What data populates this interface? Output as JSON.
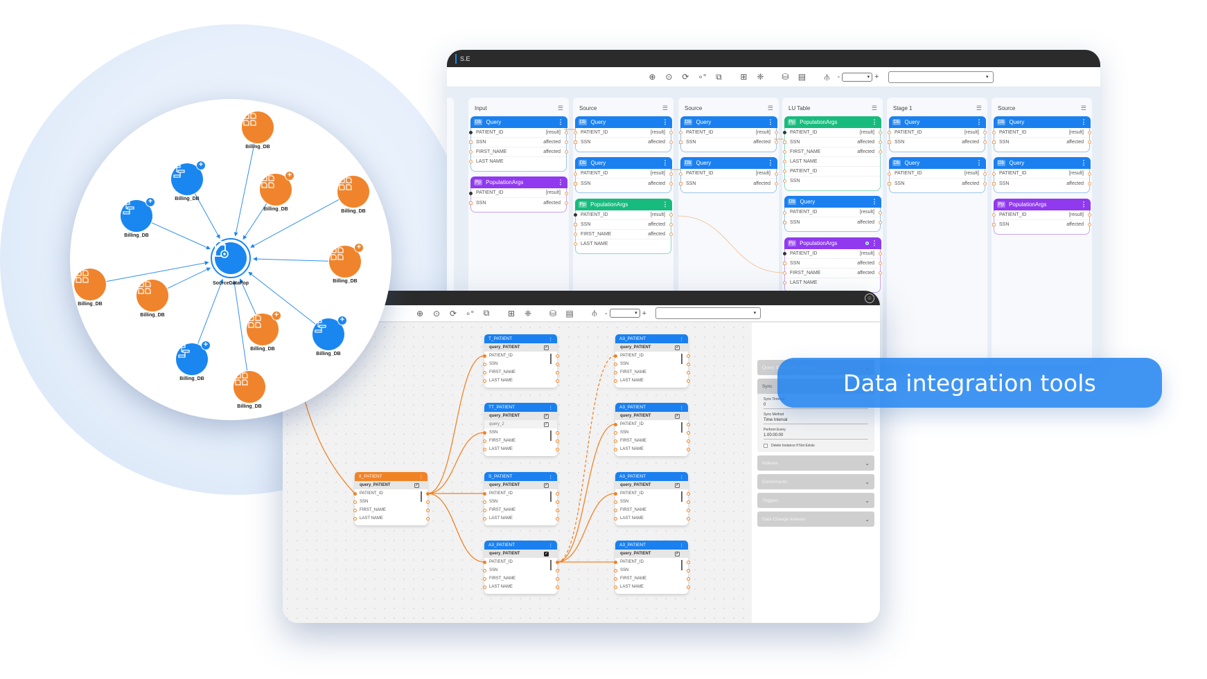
{
  "banner": {
    "text": "Data integration tools"
  },
  "colors": {
    "blue": "#1a80f0",
    "green": "#17bb7d",
    "purple": "#9039ef",
    "orange": "#f08226",
    "titlebar": "#2b2b2b"
  },
  "top_window": {
    "title": "S.E",
    "toolbar": {
      "icons": [
        "zoom-in-icon",
        "add-circle-icon",
        "refresh-icon",
        "nodes-icon",
        "group-icon",
        "add-table-icon",
        "network-icon",
        "db-search-icon",
        "table-search-icon",
        "hierarchy-icon"
      ],
      "zoom_minus": "-",
      "zoom_plus": "+",
      "zoom_value": "▾",
      "select_value": "▾"
    },
    "columns": [
      {
        "title": "Input",
        "nodes": [
          {
            "type": "Db",
            "name": "Query",
            "color": "blue",
            "rows": [
              {
                "left": "PATIENT_ID",
                "right": "[result]"
              },
              {
                "left": "SSN",
                "right": "affected"
              },
              {
                "left": "FIRST_NAME",
                "right": "affected"
              },
              {
                "left": "LAST NAME",
                "right": ""
              }
            ]
          },
          {
            "type": "Pp",
            "name": "PopulationArgs",
            "color": "purple",
            "rows": [
              {
                "left": "PATIENT_ID",
                "right": "[result]"
              },
              {
                "left": "SSN",
                "right": "affected"
              }
            ]
          }
        ]
      },
      {
        "title": "Source",
        "nodes": [
          {
            "type": "Db",
            "name": "Query",
            "color": "blue",
            "rows": [
              {
                "left": "PATIENT_ID",
                "right": "[result]"
              },
              {
                "left": "SSN",
                "right": "affected"
              }
            ]
          },
          {
            "type": "Db",
            "name": "Query",
            "color": "blue",
            "rows": [
              {
                "left": "PATIENT_ID",
                "right": "[result]"
              },
              {
                "left": "SSN",
                "right": "affected"
              }
            ]
          },
          {
            "type": "Pp",
            "name": "PopulationArgs",
            "color": "green",
            "rows": [
              {
                "left": "PATIENT_ID",
                "right": "[result]"
              },
              {
                "left": "SSN",
                "right": "affected"
              },
              {
                "left": "FIRST_NAME",
                "right": "affected"
              },
              {
                "left": "LAST NAME",
                "right": ""
              }
            ]
          }
        ]
      },
      {
        "title": "Source",
        "nodes": [
          {
            "type": "Db",
            "name": "Query",
            "color": "blue",
            "rows": [
              {
                "left": "PATIENT_ID",
                "right": "[result]"
              },
              {
                "left": "SSN",
                "right": "affected"
              }
            ]
          },
          {
            "type": "Db",
            "name": "Query",
            "color": "blue",
            "rows": [
              {
                "left": "PATIENT_ID",
                "right": "[result]"
              },
              {
                "left": "SSN",
                "right": "affected"
              }
            ]
          }
        ]
      },
      {
        "title": "LU Table",
        "nodes": [
          {
            "type": "Pp",
            "name": "PopulationArgs",
            "color": "green",
            "rows": [
              {
                "left": "PATIENT_ID",
                "right": "[result]"
              },
              {
                "left": "SSN",
                "right": "affected"
              },
              {
                "left": "FIRST_NAME",
                "right": "affected"
              },
              {
                "left": "LAST NAME",
                "right": ""
              },
              {
                "left": "PATIENT_ID",
                "right": ""
              },
              {
                "left": "SSN",
                "right": ""
              }
            ]
          },
          {
            "type": "Db",
            "name": "Query",
            "color": "blue",
            "rows": [
              {
                "left": "PATIENT_ID",
                "right": "[result]"
              },
              {
                "left": "SSN",
                "right": "affected"
              }
            ]
          },
          {
            "type": "Pp",
            "name": "PopulationArgs",
            "color": "purple",
            "status": true,
            "rows": [
              {
                "left": "PATIENT_ID",
                "right": "[result]"
              },
              {
                "left": "SSN",
                "right": "affected"
              },
              {
                "left": "FIRST_NAME",
                "right": "affected"
              },
              {
                "left": "LAST NAME",
                "right": ""
              }
            ]
          }
        ]
      },
      {
        "title": "Stage 1",
        "nodes": [
          {
            "type": "Db",
            "name": "Query",
            "color": "blue",
            "rows": [
              {
                "left": "PATIENT_ID",
                "right": "[result]"
              },
              {
                "left": "SSN",
                "right": "affected"
              }
            ]
          },
          {
            "type": "Db",
            "name": "Query",
            "color": "blue",
            "rows": [
              {
                "left": "PATIENT_ID",
                "right": "[result]"
              },
              {
                "left": "SSN",
                "right": "affected"
              }
            ]
          }
        ]
      },
      {
        "title": "Source",
        "nodes": [
          {
            "type": "Db",
            "name": "Query",
            "color": "blue",
            "rows": [
              {
                "left": "PATIENT_ID",
                "right": "[result]"
              },
              {
                "left": "SSN",
                "right": "affected"
              }
            ]
          },
          {
            "type": "Db",
            "name": "Query",
            "color": "blue",
            "rows": [
              {
                "left": "PATIENT_ID",
                "right": "[result]"
              },
              {
                "left": "SSN",
                "right": "affected"
              }
            ]
          },
          {
            "type": "Pp",
            "name": "PopulationArgs",
            "color": "purple",
            "rows": [
              {
                "left": "PATIENT_ID",
                "right": "[result]"
              },
              {
                "left": "SSN",
                "right": "affected"
              }
            ]
          }
        ]
      }
    ]
  },
  "circle_diagram": {
    "center_label": "SourceDataPop",
    "nodes": [
      {
        "label": "Billing_DB",
        "kind": "orange",
        "plus": false
      },
      {
        "label": "Billing_DB",
        "kind": "blue",
        "plus": true
      },
      {
        "label": "Billing_DB",
        "kind": "orange",
        "plus": true
      },
      {
        "label": "Billing_DB",
        "kind": "orange",
        "plus": false
      },
      {
        "label": "Billing_DB",
        "kind": "blue",
        "plus": true
      },
      {
        "label": "Billing_DB",
        "kind": "orange",
        "plus": true
      },
      {
        "label": "Billing_DB",
        "kind": "orange",
        "plus": false
      },
      {
        "label": "Billing_DB",
        "kind": "orange",
        "plus": false
      },
      {
        "label": "Billing_DB",
        "kind": "orange",
        "plus": true
      },
      {
        "label": "Billing_DB",
        "kind": "blue",
        "plus": true
      },
      {
        "label": "Billing_DB",
        "kind": "blue",
        "plus": true
      },
      {
        "label": "Billing_DB",
        "kind": "orange",
        "plus": false
      }
    ]
  },
  "bottom_window": {
    "toolbar": {
      "zoom_minus": "-",
      "zoom_plus": "+",
      "zoom_value": "▾",
      "select_value": "▾"
    },
    "tables": [
      {
        "id": "ii",
        "title": "II_PATIENT",
        "color": "orange",
        "queries": [
          {
            "name": "query_PATIENT",
            "checked": true
          }
        ],
        "fields": [
          "PATIENT_ID",
          "SSN",
          "FIRST_NAME",
          "LAST NAME"
        ]
      },
      {
        "id": "t",
        "title": "T_PATIENT",
        "color": "blue",
        "queries": [
          {
            "name": "query_PATIENT",
            "checked": true
          }
        ],
        "fields": [
          "PATIENT_ID",
          "SSN",
          "FIRST_NAME",
          "LAST NAME"
        ]
      },
      {
        "id": "tt",
        "title": "TT_PATIENT",
        "color": "blue",
        "queries": [
          {
            "name": "query_PATIENT",
            "checked": true
          },
          {
            "name": "query_2",
            "checked": true
          }
        ],
        "fields": [
          "SSN",
          "FIRST_NAME",
          "LAST NAME"
        ]
      },
      {
        "id": "s",
        "title": "S_PATIENT",
        "color": "blue",
        "queries": [
          {
            "name": "query_PATIENT",
            "checked": true
          }
        ],
        "fields": [
          "PATIENT_ID",
          "SSN",
          "FIRST_NAME",
          "LAST NAME"
        ]
      },
      {
        "id": "a3m",
        "title": "A3_PATIENT",
        "color": "blue",
        "queries": [
          {
            "name": "query_PATIENT",
            "checked": true,
            "dark": true
          }
        ],
        "fields": [
          "PATIENT_ID",
          "SSN",
          "FIRST_NAME",
          "LAST NAME"
        ]
      },
      {
        "id": "a3a",
        "title": "A3_PATIENT",
        "color": "blue",
        "queries": [
          {
            "name": "query_PATIENT",
            "checked": true
          }
        ],
        "fields": [
          "PATIENT_ID",
          "SSN",
          "FIRST_NAME",
          "LAST NAME"
        ]
      },
      {
        "id": "a3b",
        "title": "A3_PATIENT",
        "color": "blue",
        "queries": [
          {
            "name": "query_PATIENT",
            "checked": true
          }
        ],
        "fields": [
          "PATIENT_ID",
          "SSN",
          "FIRST_NAME",
          "LAST NAME"
        ]
      },
      {
        "id": "a3c",
        "title": "A3_PATIENT",
        "color": "blue",
        "queries": [
          {
            "name": "query_PATIENT",
            "checked": true
          }
        ],
        "fields": [
          "PATIENT_ID",
          "SSN",
          "FIRST_NAME",
          "LAST NAME"
        ]
      },
      {
        "id": "a3d",
        "title": "A3_PATIENT",
        "color": "blue",
        "queries": [
          {
            "name": "query_PATIENT",
            "checked": true
          }
        ],
        "fields": [
          "PATIENT_ID",
          "SSN",
          "FIRST_NAME",
          "LAST NAME"
        ]
      }
    ],
    "side_panel": {
      "sections": [
        {
          "label": "Query Statements Settings",
          "open": false
        },
        {
          "label": "Sync",
          "open": true,
          "fields": [
            {
              "label": "Sync Timeout",
              "value": "0"
            },
            {
              "label": "Sync Method",
              "value": "Time Interval"
            },
            {
              "label": "Perform Every",
              "value": "1.00:00:00"
            }
          ],
          "checkbox": {
            "label": "Delete Instance If Not Exists",
            "checked": false
          }
        },
        {
          "label": "Indexes",
          "open": false
        },
        {
          "label": "Enrichments",
          "open": false
        },
        {
          "label": "Triggers",
          "open": false
        },
        {
          "label": "Data Change Indexes",
          "open": false
        }
      ]
    }
  }
}
